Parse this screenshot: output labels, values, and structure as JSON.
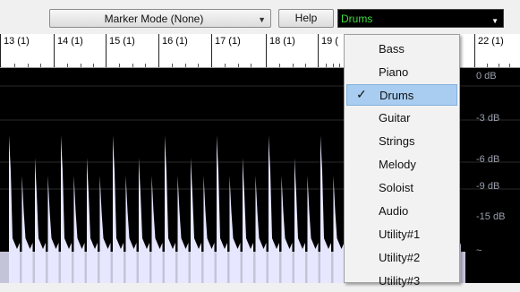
{
  "toolbar": {
    "marker_mode_label": "Marker Mode (None)",
    "help_label": "Help",
    "track_selected": "Drums"
  },
  "ruler": {
    "bars": [
      "13 (1)",
      "14 (1)",
      "15 (1)",
      "16 (1)",
      "17 (1)",
      "18 (1)",
      "19 (",
      "22 (1)"
    ]
  },
  "waveform": {
    "db_labels": [
      "0 dB",
      "-3 dB",
      "-6 dB",
      "-9 dB",
      "-15 dB",
      "~"
    ]
  },
  "track_menu": {
    "items": [
      "Bass",
      "Piano",
      "Drums",
      "Guitar",
      "Strings",
      "Melody",
      "Soloist",
      "Audio",
      "Utility#1",
      "Utility#2",
      "Utility#3"
    ],
    "selected": "Drums"
  },
  "colors": {
    "waveform": "#e6e6ff",
    "selected_text": "#3ddc3d",
    "highlight": "#a8cdf0"
  }
}
